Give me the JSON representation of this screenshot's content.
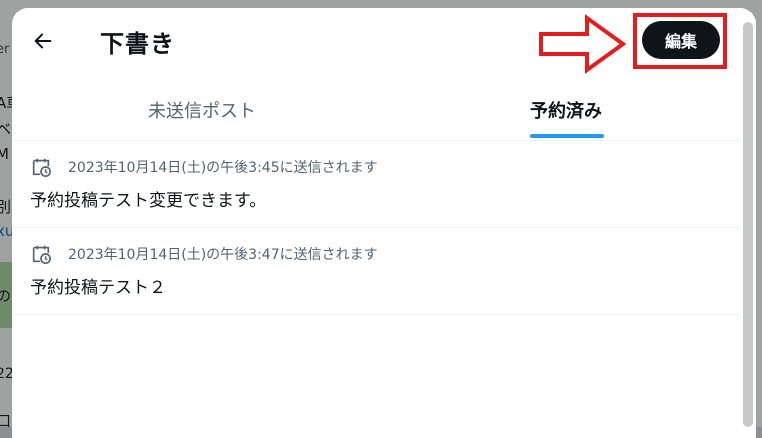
{
  "background": {
    "fragments": [
      "A車",
      "ベ",
      "M",
      "別",
      "xu",
      "の",
      "22",
      "口"
    ],
    "fragment_top_left": "er"
  },
  "header": {
    "title": "下書き",
    "edit_label": "編集"
  },
  "tabs": [
    {
      "label": "未送信ポスト",
      "active": false
    },
    {
      "label": "予約済み",
      "active": true
    }
  ],
  "scheduled_posts": [
    {
      "schedule": "2023年10月14日(土)の午後3:45に送信されます",
      "text": "予約投稿テスト変更できます。"
    },
    {
      "schedule": "2023年10月14日(土)の午後3:47に送信されます",
      "text": "予約投稿テスト２"
    }
  ],
  "colors": {
    "accent": "#1d9bf0",
    "annotation_red": "#e11d1d",
    "primary_text": "#0f1419",
    "secondary_text": "#536471"
  },
  "icons": {
    "back": "arrow-left-icon",
    "schedule": "calendar-clock-icon",
    "annotation": "arrow-right-icon"
  }
}
